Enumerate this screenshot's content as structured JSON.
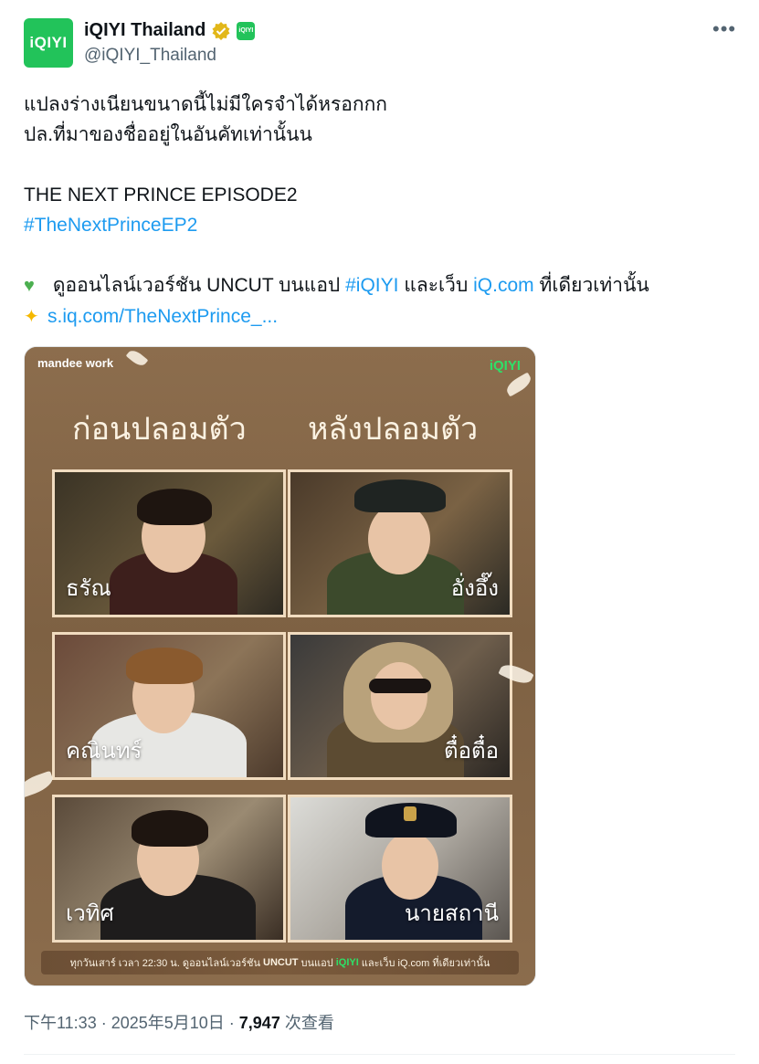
{
  "account": {
    "display_name": "iQIYI Thailand",
    "handle": "@iQIYI_Thailand",
    "avatar_text": "iQIYI",
    "brand_color": "#22c35a",
    "verified_icon": "gold-verified-badge",
    "affiliate_icon": "iqiyi-affiliate-badge"
  },
  "menu_icon": "more-horizontal-icon",
  "tweet": {
    "line1": "แปลงร่างเนียนขนาดนี้ไม่มีใครจำได้หรอกกก",
    "line2": "ปล.ที่มาของชื่ออยู่ในอันคัทเท่านั้นน",
    "line3": "THE NEXT PRINCE EPISODE2",
    "hashtag": "#TheNextPrinceEP2",
    "line5_prefix": "ดูออนไลน์เวอร์ชัน UNCUT บนแอป",
    "line5_tag": "#iQIYI",
    "line5_mid": "และเว็บ",
    "line5_link": "iQ.com",
    "line5_suffix": "ที่เดียวเท่านั้น",
    "short_link": "s.iq.com/TheNextPrince_...",
    "link_color": "#1d9bf0"
  },
  "poster": {
    "logo_left": "mandee work",
    "logo_right": "iQIYI",
    "heading_before": "ก่อนปลอมตัว",
    "heading_after": "หลังปลอมตัว",
    "panels": [
      {
        "label": "ธรัณ"
      },
      {
        "label": "อั่งอึ๊ง"
      },
      {
        "label": "คณินทร์"
      },
      {
        "label": "ตื๋อตื๋อ"
      },
      {
        "label": "เวทิศ"
      },
      {
        "label": "นายสถานี"
      }
    ],
    "banner_a": "ทุกวันเสาร์ เวลา 22:30 น. ดูออนไลน์เวอร์ชัน",
    "banner_uncut": "UNCUT",
    "banner_b": "บนแอป",
    "banner_iqiyi": "iQIYI",
    "banner_c": "และเว็บ iQ.com ที่เดียวเท่านั้น"
  },
  "meta": {
    "time": "下午11:33 · 2025年5月10日 · ",
    "views": "7,947",
    "views_label": " 次查看"
  }
}
